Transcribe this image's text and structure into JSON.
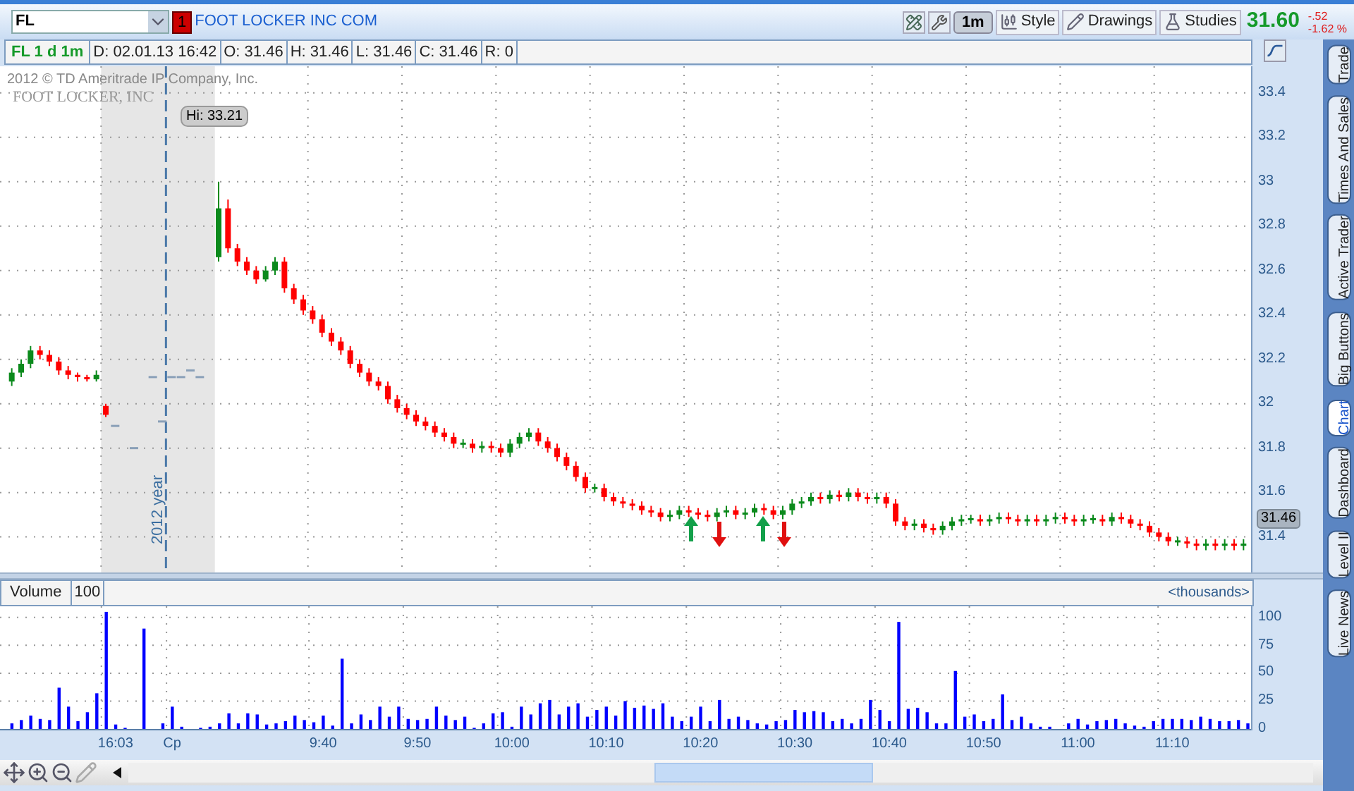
{
  "toolbar": {
    "symbol": "FL",
    "alert_badge": "1",
    "company": "FOOT LOCKER INC COM",
    "aggregation": {
      "label": "1m",
      "selected": true
    },
    "buttons": [
      {
        "kind": "style",
        "label": "Style"
      },
      {
        "kind": "drawings",
        "label": "Drawings"
      },
      {
        "kind": "studies",
        "label": "Studies"
      }
    ],
    "quote": {
      "last": "31.60",
      "change": "-.52",
      "change_percent": "-1.62 %"
    }
  },
  "info_bar": {
    "title": "FL 1 d 1m",
    "fields": [
      "D: 02.01.13 16:42",
      "O: 31.46",
      "H: 31.46",
      "L: 31.46",
      "C: 31.46",
      "R: 0"
    ]
  },
  "price_chart": {
    "copyright": "2012 © TD Ameritrade IP Company, Inc.",
    "logo": "FOOT LOCKER, INC",
    "high_label": "Hi: 33.21",
    "year_marker": "2012 year",
    "last_price": "31.46",
    "chart_data": {
      "type": "candlestick",
      "grid": true,
      "ylim": [
        31.24,
        33.52
      ],
      "yticks": [
        {
          "value": 33.4,
          "label": "33.4"
        },
        {
          "value": 33.2,
          "label": "33.2"
        },
        {
          "value": 33,
          "label": "33"
        },
        {
          "value": 32.8,
          "label": "32.8"
        },
        {
          "value": 32.6,
          "label": "32.6"
        },
        {
          "value": 32.4,
          "label": "32.4"
        },
        {
          "value": 32.2,
          "label": "32.2"
        },
        {
          "value": 32,
          "label": "32"
        },
        {
          "value": 31.8,
          "label": "31.8"
        },
        {
          "value": 31.6,
          "label": "31.6"
        },
        {
          "value": 31.4,
          "label": "31.4"
        }
      ],
      "categories": [
        null,
        null,
        null,
        null,
        null,
        null,
        null,
        null,
        null,
        null,
        null,
        null,
        null,
        null,
        null,
        null,
        null,
        null,
        null,
        null,
        null,
        null,
        null,
        null,
        null,
        null,
        null,
        null,
        null,
        null,
        null,
        null,
        null,
        null,
        null,
        null,
        null,
        null,
        null,
        null,
        null,
        null,
        null,
        null,
        null,
        null,
        null,
        null,
        null,
        null,
        null,
        null,
        null,
        null,
        null,
        null,
        null,
        null,
        null,
        null,
        null,
        null,
        null,
        null,
        null,
        null,
        null,
        null,
        null,
        null,
        null,
        null,
        null,
        null,
        null,
        null,
        null,
        null,
        null,
        null,
        null,
        null,
        null,
        null,
        null,
        null,
        null,
        null,
        null,
        null,
        null,
        null,
        null,
        null,
        null,
        null,
        null,
        null,
        null,
        null,
        null,
        null,
        null,
        null,
        null,
        null,
        null,
        null,
        null,
        null,
        null,
        null,
        null,
        null,
        null,
        null,
        null,
        null,
        null,
        null,
        null,
        null,
        null,
        null,
        null,
        null,
        null,
        null,
        null,
        null,
        null,
        null
      ],
      "ohlc": [
        [
          32.1,
          32.16,
          32.08,
          32.14
        ],
        [
          32.14,
          32.2,
          32.12,
          32.18
        ],
        [
          32.18,
          32.26,
          32.16,
          32.24
        ],
        [
          32.24,
          32.26,
          32.2,
          32.22
        ],
        [
          32.22,
          32.24,
          32.17,
          32.19
        ],
        [
          32.19,
          32.21,
          32.13,
          32.15
        ],
        [
          32.15,
          32.17,
          32.11,
          32.13
        ],
        [
          32.13,
          32.14,
          32.1,
          32.12
        ],
        [
          32.12,
          32.13,
          32.1,
          32.11
        ],
        [
          32.11,
          32.15,
          32.1,
          32.13
        ],
        [
          31.99,
          32.0,
          31.94,
          31.95
        ],
        [
          31.9,
          31.9,
          31.9,
          31.9
        ],
        null,
        [
          31.8,
          31.8,
          31.8,
          31.8
        ],
        null,
        [
          32.12,
          32.12,
          32.12,
          32.12
        ],
        [
          31.92,
          31.92,
          31.92,
          31.92
        ],
        [
          32.12,
          32.12,
          32.12,
          32.12
        ],
        [
          32.12,
          32.12,
          32.12,
          32.12
        ],
        [
          32.15,
          32.15,
          32.15,
          32.15
        ],
        [
          32.12,
          32.12,
          32.12,
          32.12
        ],
        null,
        [
          32.66,
          33.0,
          32.64,
          32.88
        ],
        [
          32.88,
          32.92,
          32.68,
          32.7
        ],
        [
          32.7,
          32.72,
          32.62,
          32.64
        ],
        [
          32.64,
          32.66,
          32.58,
          32.6
        ],
        [
          32.6,
          32.62,
          32.54,
          32.56
        ],
        [
          32.56,
          32.62,
          32.55,
          32.6
        ],
        [
          32.6,
          32.66,
          32.58,
          32.64
        ],
        [
          32.64,
          32.66,
          32.5,
          32.52
        ],
        [
          32.52,
          32.54,
          32.45,
          32.47
        ],
        [
          32.47,
          32.49,
          32.4,
          32.42
        ],
        [
          32.42,
          32.44,
          32.36,
          32.38
        ],
        [
          32.38,
          32.4,
          32.3,
          32.32
        ],
        [
          32.32,
          32.34,
          32.26,
          32.28
        ],
        [
          32.28,
          32.3,
          32.22,
          32.24
        ],
        [
          32.24,
          32.26,
          32.16,
          32.18
        ],
        [
          32.18,
          32.2,
          32.12,
          32.14
        ],
        [
          32.14,
          32.16,
          32.08,
          32.1
        ],
        [
          32.1,
          32.12,
          32.06,
          32.08
        ],
        [
          32.08,
          32.1,
          32.0,
          32.02
        ],
        [
          32.02,
          32.04,
          31.96,
          31.98
        ],
        [
          31.98,
          32.0,
          31.93,
          31.95
        ],
        [
          31.95,
          31.97,
          31.9,
          31.92
        ],
        [
          31.92,
          31.94,
          31.88,
          31.9
        ],
        [
          31.9,
          31.92,
          31.85,
          31.87
        ],
        [
          31.87,
          31.89,
          31.83,
          31.85
        ],
        [
          31.85,
          31.87,
          31.8,
          31.82
        ],
        [
          31.82,
          31.84,
          31.8,
          31.82
        ],
        [
          31.82,
          31.84,
          31.78,
          31.8
        ],
        [
          31.8,
          31.83,
          31.78,
          31.81
        ],
        [
          31.81,
          31.83,
          31.78,
          31.8
        ],
        [
          31.8,
          31.82,
          31.76,
          31.78
        ],
        [
          31.78,
          31.84,
          31.76,
          31.82
        ],
        [
          31.82,
          31.87,
          31.8,
          31.85
        ],
        [
          31.85,
          31.89,
          31.83,
          31.87
        ],
        [
          31.87,
          31.89,
          31.81,
          31.83
        ],
        [
          31.83,
          31.85,
          31.78,
          31.8
        ],
        [
          31.8,
          31.82,
          31.74,
          31.76
        ],
        [
          31.76,
          31.78,
          31.7,
          31.72
        ],
        [
          31.72,
          31.74,
          31.65,
          31.67
        ],
        [
          31.67,
          31.69,
          31.6,
          31.62
        ],
        [
          31.62,
          31.64,
          31.6,
          31.62
        ],
        [
          31.62,
          31.64,
          31.56,
          31.58
        ],
        [
          31.58,
          31.6,
          31.54,
          31.56
        ],
        [
          31.56,
          31.58,
          31.53,
          31.55
        ],
        [
          31.55,
          31.57,
          31.52,
          31.54
        ],
        [
          31.54,
          31.56,
          31.5,
          31.52
        ],
        [
          31.52,
          31.54,
          31.49,
          31.51
        ],
        [
          31.51,
          31.53,
          31.47,
          31.49
        ],
        [
          31.49,
          31.52,
          31.47,
          31.5
        ],
        [
          31.5,
          31.54,
          31.48,
          31.52
        ],
        [
          31.52,
          31.54,
          31.49,
          31.51
        ],
        [
          31.51,
          31.53,
          31.48,
          31.5
        ],
        [
          31.5,
          31.52,
          31.47,
          31.49
        ],
        [
          31.49,
          31.53,
          31.47,
          31.51
        ],
        [
          31.51,
          31.54,
          31.49,
          31.52
        ],
        [
          31.52,
          31.54,
          31.48,
          31.5
        ],
        [
          31.5,
          31.53,
          31.48,
          31.51
        ],
        [
          31.51,
          31.55,
          31.49,
          31.53
        ],
        [
          31.53,
          31.55,
          31.5,
          31.52
        ],
        [
          31.52,
          31.54,
          31.48,
          31.5
        ],
        [
          31.5,
          31.54,
          31.48,
          31.52
        ],
        [
          31.52,
          31.57,
          31.5,
          31.55
        ],
        [
          31.55,
          31.58,
          31.53,
          31.56
        ],
        [
          31.56,
          31.6,
          31.54,
          31.58
        ],
        [
          31.58,
          31.6,
          31.55,
          31.57
        ],
        [
          31.57,
          31.61,
          31.55,
          31.59
        ],
        [
          31.59,
          31.61,
          31.56,
          31.58
        ],
        [
          31.58,
          31.62,
          31.56,
          31.6
        ],
        [
          31.6,
          31.62,
          31.56,
          31.58
        ],
        [
          31.58,
          31.6,
          31.55,
          31.57
        ],
        [
          31.57,
          31.6,
          31.55,
          31.58
        ],
        [
          31.58,
          31.6,
          31.53,
          31.55
        ],
        [
          31.55,
          31.57,
          31.45,
          31.47
        ],
        [
          31.47,
          31.49,
          31.43,
          31.45
        ],
        [
          31.45,
          31.48,
          31.43,
          31.46
        ],
        [
          31.46,
          31.48,
          31.42,
          31.44
        ],
        [
          31.44,
          31.46,
          31.41,
          31.43
        ],
        [
          31.43,
          31.47,
          31.41,
          31.45
        ],
        [
          31.45,
          31.49,
          31.43,
          31.47
        ],
        [
          31.47,
          31.5,
          31.45,
          31.48
        ],
        [
          31.48,
          31.5,
          31.46,
          31.48
        ],
        [
          31.48,
          31.5,
          31.45,
          31.47
        ],
        [
          31.47,
          31.5,
          31.45,
          31.48
        ],
        [
          31.48,
          31.51,
          31.46,
          31.49
        ],
        [
          31.49,
          31.51,
          31.46,
          31.48
        ],
        [
          31.48,
          31.5,
          31.45,
          31.47
        ],
        [
          31.47,
          31.5,
          31.45,
          31.48
        ],
        [
          31.48,
          31.5,
          31.45,
          31.47
        ],
        [
          31.47,
          31.5,
          31.45,
          31.48
        ],
        [
          31.48,
          31.51,
          31.46,
          31.49
        ],
        [
          31.49,
          31.51,
          31.46,
          31.48
        ],
        [
          31.48,
          31.5,
          31.45,
          31.47
        ],
        [
          31.47,
          31.5,
          31.45,
          31.48
        ],
        [
          31.48,
          31.5,
          31.46,
          31.48
        ],
        [
          31.48,
          31.5,
          31.45,
          31.47
        ],
        [
          31.47,
          31.51,
          31.45,
          31.49
        ],
        [
          31.49,
          31.51,
          31.46,
          31.48
        ],
        [
          31.48,
          31.5,
          31.44,
          31.46
        ],
        [
          31.46,
          31.48,
          31.43,
          31.45
        ],
        [
          31.45,
          31.47,
          31.4,
          31.42
        ],
        [
          31.42,
          31.44,
          31.38,
          31.4
        ],
        [
          31.4,
          31.42,
          31.36,
          31.38
        ],
        [
          31.38,
          31.4,
          31.36,
          31.38
        ],
        [
          31.38,
          31.4,
          31.35,
          31.37
        ],
        [
          31.37,
          31.39,
          31.34,
          31.36
        ],
        [
          31.36,
          31.39,
          31.34,
          31.37
        ],
        [
          31.37,
          31.39,
          31.34,
          31.36
        ],
        [
          31.36,
          31.39,
          31.34,
          31.37
        ],
        [
          31.37,
          31.39,
          31.34,
          31.36
        ],
        [
          31.36,
          31.39,
          31.34,
          31.37
        ]
      ]
    }
  },
  "volume_panel": {
    "period": "100",
    "units": "<thousands>",
    "chart_data": {
      "type": "bar",
      "grid": true,
      "ylim": [
        0,
        110
      ],
      "yticks": [
        {
          "value": 0,
          "label": "0"
        },
        {
          "value": 25,
          "label": "25"
        },
        {
          "value": 50,
          "label": "50"
        },
        {
          "value": 75,
          "label": "75"
        },
        {
          "value": 100,
          "label": "100"
        }
      ],
      "categories": [
        null,
        null,
        null,
        null,
        null,
        null,
        null,
        null,
        null,
        null,
        null,
        "16:03",
        null,
        null,
        null,
        null,
        null,
        "Cp",
        null,
        null,
        null,
        null,
        null,
        null,
        null,
        null,
        null,
        null,
        null,
        null,
        null,
        null,
        null,
        "9:40",
        null,
        null,
        null,
        null,
        null,
        null,
        null,
        null,
        null,
        "9:50",
        null,
        null,
        null,
        null,
        null,
        null,
        null,
        null,
        null,
        "10:00",
        null,
        null,
        null,
        null,
        null,
        null,
        null,
        null,
        null,
        "10:10",
        null,
        null,
        null,
        null,
        null,
        null,
        null,
        null,
        null,
        "10:20",
        null,
        null,
        null,
        null,
        null,
        null,
        null,
        null,
        null,
        "10:30",
        null,
        null,
        null,
        null,
        null,
        null,
        null,
        null,
        null,
        "10:40",
        null,
        null,
        null,
        null,
        null,
        null,
        null,
        null,
        null,
        "10:50",
        null,
        null,
        null,
        null,
        null,
        null,
        null,
        null,
        null,
        "11:00",
        null,
        null,
        null,
        null,
        null,
        null,
        null,
        null,
        null,
        "11:10",
        null,
        null,
        null,
        null,
        null,
        null,
        null,
        null
      ],
      "series": [
        {
          "name": "Volume",
          "color": "#0000ff",
          "values": [
            5,
            8,
            12,
            9,
            8,
            37,
            20,
            7,
            15,
            32,
            105,
            4,
            1,
            null,
            90,
            null,
            5,
            20,
            2,
            null,
            1,
            2,
            5,
            14,
            5,
            14,
            13,
            4,
            5,
            7,
            12,
            8,
            6,
            12,
            3,
            63,
            5,
            13,
            8,
            20,
            11,
            20,
            9,
            8,
            9,
            20,
            12,
            8,
            11,
            1,
            5,
            14,
            15,
            2,
            20,
            13,
            23,
            26,
            13,
            20,
            23,
            11,
            17,
            20,
            12,
            25,
            19,
            21,
            18,
            23,
            11,
            7,
            11,
            20,
            7,
            26,
            9,
            11,
            8,
            5,
            4,
            7,
            8,
            17,
            15,
            16,
            15,
            7,
            9,
            5,
            9,
            26,
            17,
            7,
            96,
            18,
            19,
            15,
            5,
            5,
            52,
            11,
            13,
            7,
            9,
            31,
            8,
            11,
            5,
            2,
            2,
            null,
            5,
            9,
            4,
            7,
            8,
            9,
            5,
            3,
            2,
            7,
            9,
            9,
            9,
            8,
            11,
            9,
            7,
            7,
            8,
            5
          ]
        }
      ]
    }
  },
  "side_tabs": [
    {
      "label": "Trade",
      "selected": false
    },
    {
      "label": "Times And Sales",
      "selected": false
    },
    {
      "label": "Active Trader",
      "selected": false
    },
    {
      "label": "Big Buttons",
      "selected": false
    },
    {
      "label": "Chart",
      "selected": true
    },
    {
      "label": "Dashboard",
      "selected": false
    },
    {
      "label": "Level II",
      "selected": false
    },
    {
      "label": "Live News",
      "selected": false
    }
  ]
}
